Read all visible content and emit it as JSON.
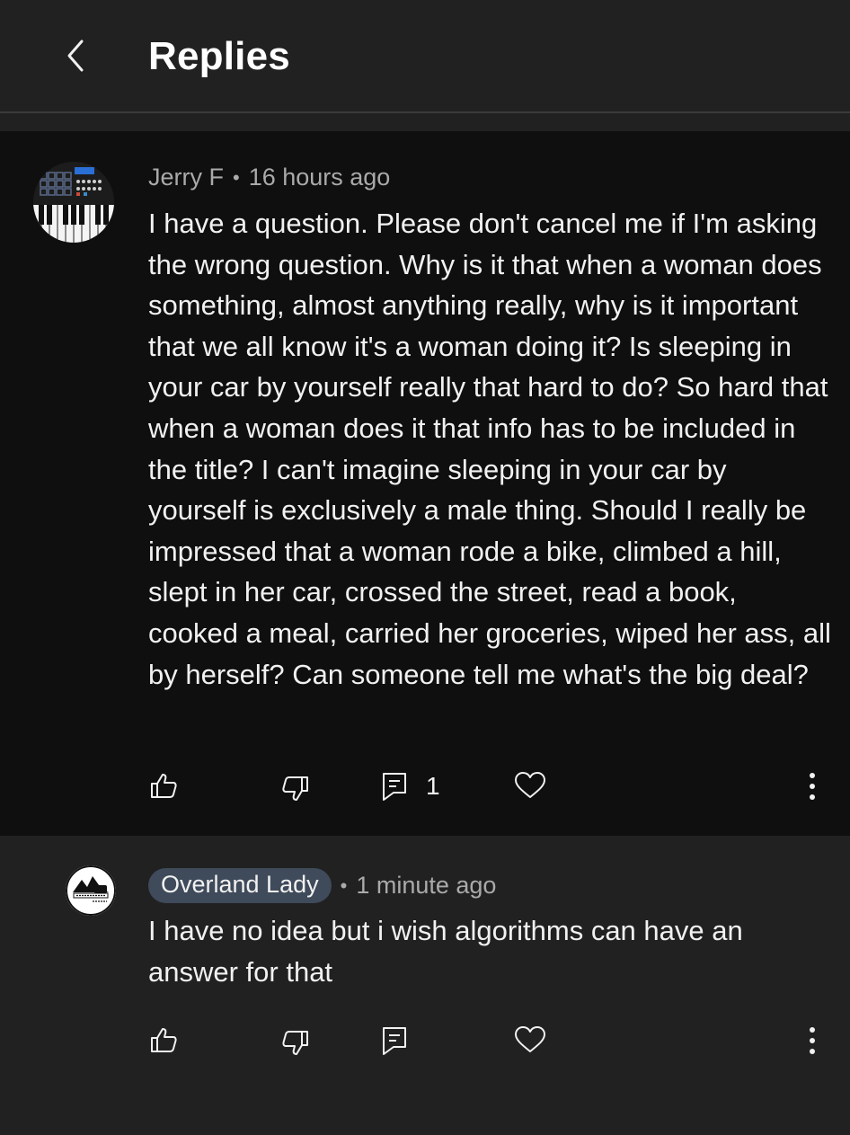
{
  "header": {
    "title": "Replies",
    "back_icon": "chevron-left-icon"
  },
  "top_comment": {
    "author": "Jerry F",
    "separator": "•",
    "time": "16 hours ago",
    "text": "I have a question. Please don't cancel me if I'm asking the wrong question. Why is it that when a woman does something, almost anything really, why is it important that we all know it's a woman doing it? Is sleeping in your car by yourself really that hard to do? So hard that when a woman does it that info has to be included in the title? I can't imagine sleeping in your car by yourself is exclusively a male thing. Should I really be impressed that a woman rode a bike, climbed a hill, slept in her car, crossed the street, read a book, cooked a meal, carried her groceries, wiped her ass, all by herself? Can someone tell me what's the big deal?",
    "reply_count": "1",
    "avatar_icon": "keyboard-synth-avatar"
  },
  "reply": {
    "author": "Overland Lady",
    "separator": "•",
    "time": "1 minute ago",
    "text": "I have no idea but i wish algorithms can have an answer for that",
    "avatar_icon": "overland-lady-logo-avatar",
    "avatar_logo_text": "OVERLAND LADY"
  },
  "icons": {
    "like": "thumbs-up-icon",
    "dislike": "thumbs-down-icon",
    "reply": "reply-comment-icon",
    "heart": "heart-icon",
    "more": "more-vertical-icon"
  },
  "colors": {
    "background": "#212121",
    "highlight_background": "#0f0f0f",
    "text": "#f1f1f1",
    "meta_text": "#aaaaaa",
    "author_chip": "#3f4a5a"
  }
}
